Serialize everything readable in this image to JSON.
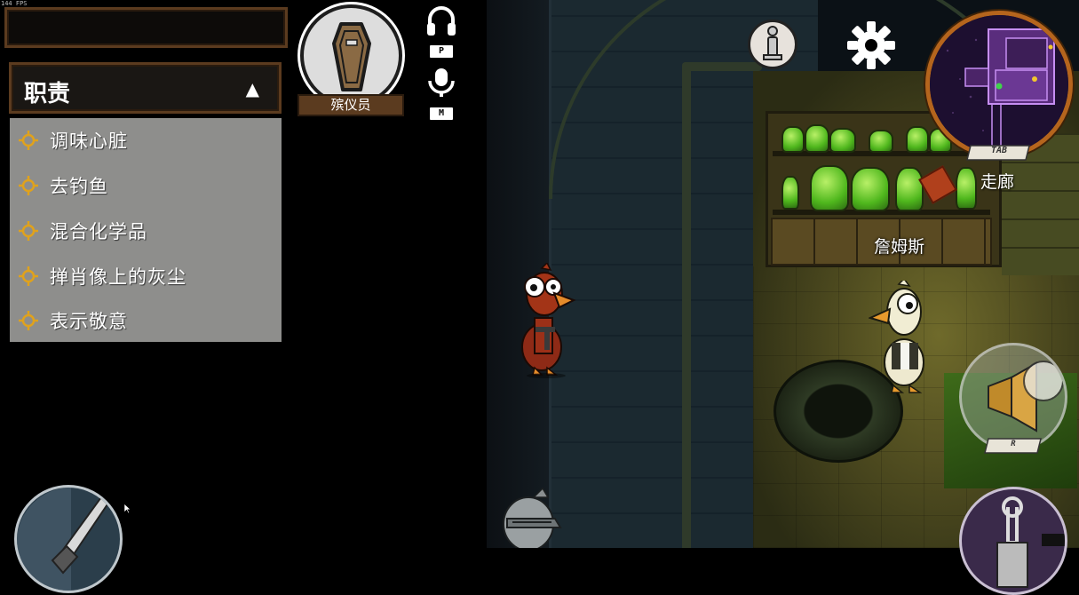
{
  "fps": "144 FPS",
  "tasks": {
    "title": "职责",
    "toggle": "▲",
    "items": [
      {
        "label": "调味心脏"
      },
      {
        "label": "去钓鱼"
      },
      {
        "label": "混合化学品"
      },
      {
        "label": "掸肖像上的灰尘"
      },
      {
        "label": "表示敬意"
      }
    ]
  },
  "role": {
    "name": "殡仪员",
    "icon": "coffin-icon"
  },
  "voice": {
    "listen_key": "P",
    "talk_key": "M"
  },
  "minimap": {
    "key": "TAB",
    "location": "走廊"
  },
  "players": [
    {
      "name": "詹姆斯"
    }
  ],
  "buttons": {
    "report_key": "R"
  },
  "colors": {
    "panel_border": "#5b3b1f",
    "task_list_bg": "#8e8e8c",
    "task_icon": "#e0a21c",
    "minimap_ring": "#b5651d",
    "room_light": "#6f6a2b"
  }
}
